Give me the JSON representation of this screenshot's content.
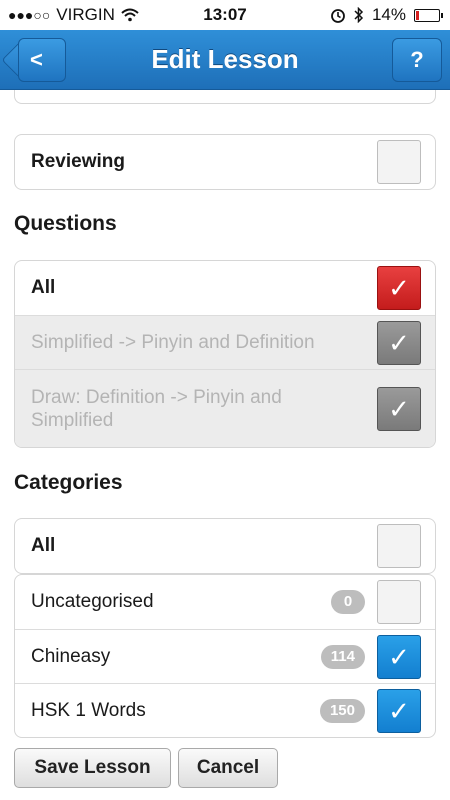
{
  "status": {
    "carrier": "VIRGIN",
    "time": "13:07",
    "battery": "14%",
    "battery_level": 0.14
  },
  "header": {
    "title": "Edit Lesson",
    "back_label": "<",
    "help_label": "?"
  },
  "reviewing": {
    "label": "Reviewing",
    "checked": false
  },
  "questions": {
    "title": "Questions",
    "all_label": "All",
    "items": [
      {
        "label": "Simplified -> Pinyin and Definition",
        "checked": true
      },
      {
        "label": "Draw: Definition -> Pinyin and Simplified",
        "checked": true
      }
    ]
  },
  "categories": {
    "title": "Categories",
    "all_label": "All",
    "items": [
      {
        "label": "Uncategorised",
        "count": "0",
        "checked": false
      },
      {
        "label": "Chineasy",
        "count": "114",
        "checked": true
      },
      {
        "label": "HSK 1 Words",
        "count": "150",
        "checked": true
      }
    ]
  },
  "actions": {
    "save_label": "Save Lesson",
    "cancel_label": "Cancel"
  },
  "colors": {
    "header_blue": "#1e6fb8",
    "check_red": "#d42a2a",
    "check_blue": "#1a8ddc",
    "check_grey": "#8a8a8a"
  },
  "icons": [
    "signal-dots-icon",
    "wifi-icon",
    "alarm-icon",
    "bluetooth-icon",
    "battery-icon",
    "checkmark-icon"
  ]
}
